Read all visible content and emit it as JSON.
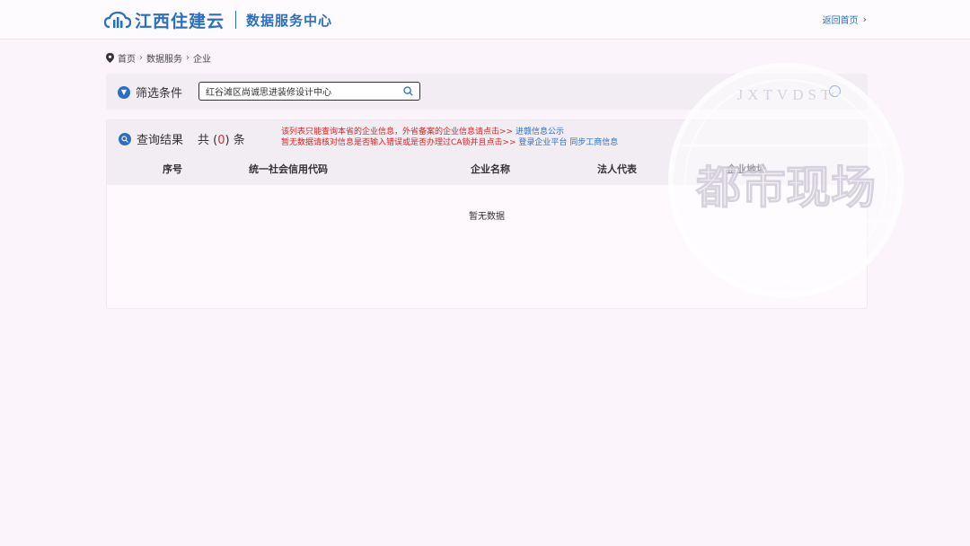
{
  "header": {
    "logo_text": "江西住建云",
    "logo_sub": "数据服务中心",
    "back_label": "返回首页"
  },
  "breadcrumb": {
    "items": [
      "首页",
      "数据服务",
      "企业"
    ]
  },
  "filter": {
    "title": "筛选条件",
    "search_value": "红谷滩区尚诚思进装修设计中心"
  },
  "results": {
    "title": "查询结果",
    "count_prefix": "共",
    "count_open": "(",
    "count": "0",
    "count_close": ")",
    "count_suffix": "条",
    "notice_line1_text": "该列表只能查询本省的企业信息，外省备案的企业信息请点击>>",
    "notice_line1_link": "进赣信息公示",
    "notice_line2_text": "暂无数据请核对信息是否输入错误或是否办理过CA锁并且点击>>",
    "notice_line2_link1": "登录企业平台",
    "notice_line2_link2": "同步工商信息",
    "columns": [
      "序号",
      "统一社会信用代码",
      "企业名称",
      "法人代表",
      "企业地址"
    ],
    "empty_text": "暂无数据"
  },
  "watermark": {
    "top_text": "JXTVDST",
    "main_text": "都市现场"
  },
  "colors": {
    "brand": "#2b6fc4",
    "notice": "#dd2222",
    "background": "#fbf5fb"
  }
}
